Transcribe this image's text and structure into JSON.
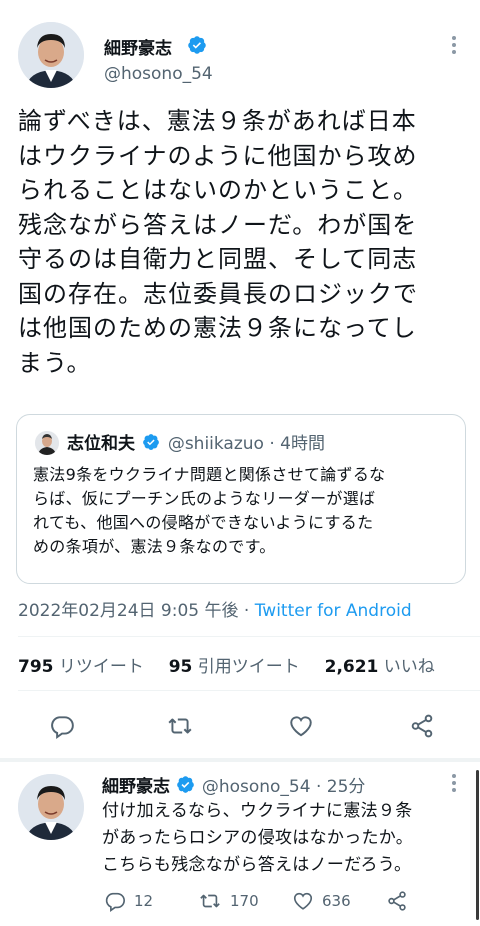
{
  "main_tweet": {
    "author_name": "細野豪志",
    "author_handle": "@hosono_54",
    "body_lines": [
      "論ずべきは、憲法９条があれば日本",
      "はウクライナのように他国から攻め",
      "られることはないのかということ。",
      "残念ながら答えはノーだ。わが国を",
      "守るのは自衛力と同盟、そして同志",
      "国の存在。志位委員長のロジックで",
      "は他国のための憲法９条になってし",
      "まう。"
    ],
    "quote": {
      "author_name": "志位和夫",
      "author_handle": "@shiikazuo",
      "time": "· 4時間",
      "body_lines": [
        "憲法9条をウクライナ問題と関係させて論ずるな",
        "らば、仮にプーチン氏のようなリーダーが選ば",
        "れても、他国への侵略ができないようにするた",
        "めの条項が、憲法９条なのです。"
      ]
    },
    "timestamp": "2022年02月24日 9:05 午後 · ",
    "source": "Twitter for Android",
    "stats": {
      "retweets_count": "795",
      "retweets_label": "リツイート",
      "quotes_count": "95",
      "quotes_label": "引用ツイート",
      "likes_count": "2,621",
      "likes_label": "いいね"
    }
  },
  "reply_tweet": {
    "author_name": "細野豪志",
    "author_handle": "@hosono_54 · 25分",
    "body_lines": [
      "付け加えるなら、ウクライナに憲法９条",
      "があったらロシアの侵攻はなかったか。",
      "こちらも残念ながら答えはノーだろう。"
    ],
    "replies": "12",
    "retweets": "170",
    "likes": "636"
  },
  "colors": {
    "accent": "#1d9bf0",
    "muted": "#536471",
    "text": "#0f1419",
    "border": "#cfd9de"
  },
  "icons": [
    "verified-badge-icon",
    "more-options-icon",
    "reply-icon",
    "retweet-icon",
    "like-icon",
    "share-icon"
  ]
}
